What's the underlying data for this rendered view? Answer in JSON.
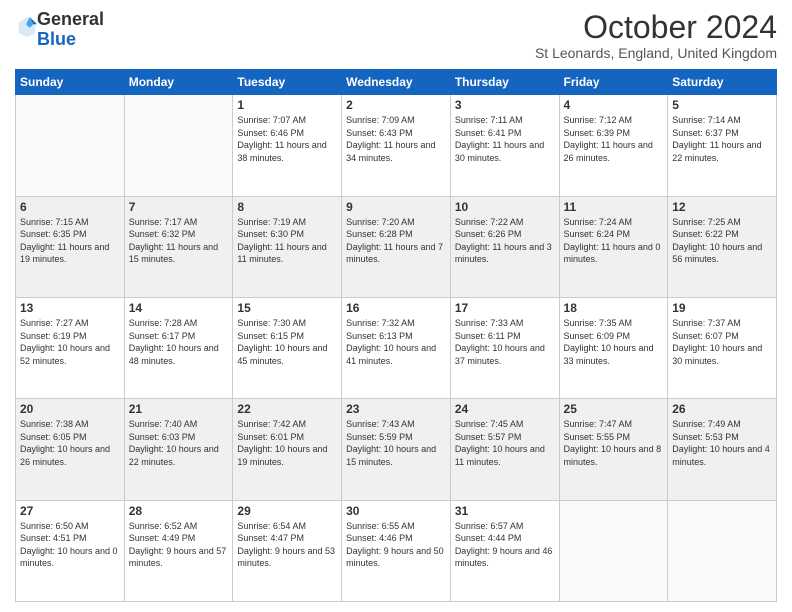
{
  "logo": {
    "general": "General",
    "blue": "Blue"
  },
  "title": "October 2024",
  "subtitle": "St Leonards, England, United Kingdom",
  "weekdays": [
    "Sunday",
    "Monday",
    "Tuesday",
    "Wednesday",
    "Thursday",
    "Friday",
    "Saturday"
  ],
  "weeks": [
    [
      {
        "day": "",
        "empty": true
      },
      {
        "day": "",
        "empty": true
      },
      {
        "day": "1",
        "sunrise": "7:07 AM",
        "sunset": "6:46 PM",
        "daylight": "11 hours and 38 minutes."
      },
      {
        "day": "2",
        "sunrise": "7:09 AM",
        "sunset": "6:43 PM",
        "daylight": "11 hours and 34 minutes."
      },
      {
        "day": "3",
        "sunrise": "7:11 AM",
        "sunset": "6:41 PM",
        "daylight": "11 hours and 30 minutes."
      },
      {
        "day": "4",
        "sunrise": "7:12 AM",
        "sunset": "6:39 PM",
        "daylight": "11 hours and 26 minutes."
      },
      {
        "day": "5",
        "sunrise": "7:14 AM",
        "sunset": "6:37 PM",
        "daylight": "11 hours and 22 minutes."
      }
    ],
    [
      {
        "day": "6",
        "sunrise": "7:15 AM",
        "sunset": "6:35 PM",
        "daylight": "11 hours and 19 minutes."
      },
      {
        "day": "7",
        "sunrise": "7:17 AM",
        "sunset": "6:32 PM",
        "daylight": "11 hours and 15 minutes."
      },
      {
        "day": "8",
        "sunrise": "7:19 AM",
        "sunset": "6:30 PM",
        "daylight": "11 hours and 11 minutes."
      },
      {
        "day": "9",
        "sunrise": "7:20 AM",
        "sunset": "6:28 PM",
        "daylight": "11 hours and 7 minutes."
      },
      {
        "day": "10",
        "sunrise": "7:22 AM",
        "sunset": "6:26 PM",
        "daylight": "11 hours and 3 minutes."
      },
      {
        "day": "11",
        "sunrise": "7:24 AM",
        "sunset": "6:24 PM",
        "daylight": "11 hours and 0 minutes."
      },
      {
        "day": "12",
        "sunrise": "7:25 AM",
        "sunset": "6:22 PM",
        "daylight": "10 hours and 56 minutes."
      }
    ],
    [
      {
        "day": "13",
        "sunrise": "7:27 AM",
        "sunset": "6:19 PM",
        "daylight": "10 hours and 52 minutes."
      },
      {
        "day": "14",
        "sunrise": "7:28 AM",
        "sunset": "6:17 PM",
        "daylight": "10 hours and 48 minutes."
      },
      {
        "day": "15",
        "sunrise": "7:30 AM",
        "sunset": "6:15 PM",
        "daylight": "10 hours and 45 minutes."
      },
      {
        "day": "16",
        "sunrise": "7:32 AM",
        "sunset": "6:13 PM",
        "daylight": "10 hours and 41 minutes."
      },
      {
        "day": "17",
        "sunrise": "7:33 AM",
        "sunset": "6:11 PM",
        "daylight": "10 hours and 37 minutes."
      },
      {
        "day": "18",
        "sunrise": "7:35 AM",
        "sunset": "6:09 PM",
        "daylight": "10 hours and 33 minutes."
      },
      {
        "day": "19",
        "sunrise": "7:37 AM",
        "sunset": "6:07 PM",
        "daylight": "10 hours and 30 minutes."
      }
    ],
    [
      {
        "day": "20",
        "sunrise": "7:38 AM",
        "sunset": "6:05 PM",
        "daylight": "10 hours and 26 minutes."
      },
      {
        "day": "21",
        "sunrise": "7:40 AM",
        "sunset": "6:03 PM",
        "daylight": "10 hours and 22 minutes."
      },
      {
        "day": "22",
        "sunrise": "7:42 AM",
        "sunset": "6:01 PM",
        "daylight": "10 hours and 19 minutes."
      },
      {
        "day": "23",
        "sunrise": "7:43 AM",
        "sunset": "5:59 PM",
        "daylight": "10 hours and 15 minutes."
      },
      {
        "day": "24",
        "sunrise": "7:45 AM",
        "sunset": "5:57 PM",
        "daylight": "10 hours and 11 minutes."
      },
      {
        "day": "25",
        "sunrise": "7:47 AM",
        "sunset": "5:55 PM",
        "daylight": "10 hours and 8 minutes."
      },
      {
        "day": "26",
        "sunrise": "7:49 AM",
        "sunset": "5:53 PM",
        "daylight": "10 hours and 4 minutes."
      }
    ],
    [
      {
        "day": "27",
        "sunrise": "6:50 AM",
        "sunset": "4:51 PM",
        "daylight": "10 hours and 0 minutes."
      },
      {
        "day": "28",
        "sunrise": "6:52 AM",
        "sunset": "4:49 PM",
        "daylight": "9 hours and 57 minutes."
      },
      {
        "day": "29",
        "sunrise": "6:54 AM",
        "sunset": "4:47 PM",
        "daylight": "9 hours and 53 minutes."
      },
      {
        "day": "30",
        "sunrise": "6:55 AM",
        "sunset": "4:46 PM",
        "daylight": "9 hours and 50 minutes."
      },
      {
        "day": "31",
        "sunrise": "6:57 AM",
        "sunset": "4:44 PM",
        "daylight": "9 hours and 46 minutes."
      },
      {
        "day": "",
        "empty": true
      },
      {
        "day": "",
        "empty": true
      }
    ]
  ]
}
